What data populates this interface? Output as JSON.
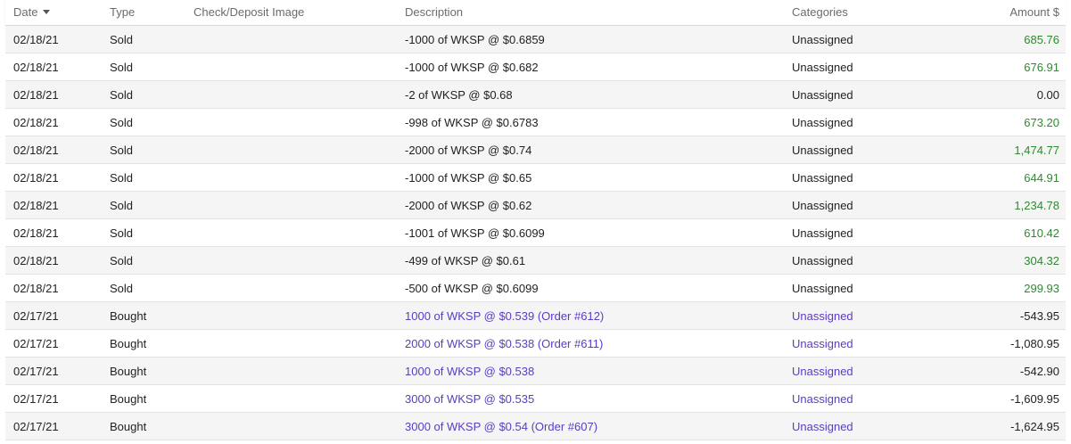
{
  "headers": {
    "date": "Date",
    "type": "Type",
    "image": "Check/Deposit Image",
    "description": "Description",
    "categories": "Categories",
    "amount": "Amount $"
  },
  "rows": [
    {
      "date": "02/18/21",
      "type": "Sold",
      "description": "-1000 of WKSP @ $0.6859",
      "category": "Unassigned",
      "amount": "685.76",
      "sign": "pos",
      "link": false
    },
    {
      "date": "02/18/21",
      "type": "Sold",
      "description": "-1000 of WKSP @ $0.682",
      "category": "Unassigned",
      "amount": "676.91",
      "sign": "pos",
      "link": false
    },
    {
      "date": "02/18/21",
      "type": "Sold",
      "description": "-2 of WKSP @ $0.68",
      "category": "Unassigned",
      "amount": "0.00",
      "sign": "zero",
      "link": false
    },
    {
      "date": "02/18/21",
      "type": "Sold",
      "description": "-998 of WKSP @ $0.6783",
      "category": "Unassigned",
      "amount": "673.20",
      "sign": "pos",
      "link": false
    },
    {
      "date": "02/18/21",
      "type": "Sold",
      "description": "-2000 of WKSP @ $0.74",
      "category": "Unassigned",
      "amount": "1,474.77",
      "sign": "pos",
      "link": false
    },
    {
      "date": "02/18/21",
      "type": "Sold",
      "description": "-1000 of WKSP @ $0.65",
      "category": "Unassigned",
      "amount": "644.91",
      "sign": "pos",
      "link": false
    },
    {
      "date": "02/18/21",
      "type": "Sold",
      "description": "-2000 of WKSP @ $0.62",
      "category": "Unassigned",
      "amount": "1,234.78",
      "sign": "pos",
      "link": false
    },
    {
      "date": "02/18/21",
      "type": "Sold",
      "description": "-1001 of WKSP @ $0.6099",
      "category": "Unassigned",
      "amount": "610.42",
      "sign": "pos",
      "link": false
    },
    {
      "date": "02/18/21",
      "type": "Sold",
      "description": "-499 of WKSP @ $0.61",
      "category": "Unassigned",
      "amount": "304.32",
      "sign": "pos",
      "link": false
    },
    {
      "date": "02/18/21",
      "type": "Sold",
      "description": "-500 of WKSP @ $0.6099",
      "category": "Unassigned",
      "amount": "299.93",
      "sign": "pos",
      "link": false
    },
    {
      "date": "02/17/21",
      "type": "Bought",
      "description": "1000 of WKSP @ $0.539 (Order #612)",
      "category": "Unassigned",
      "amount": "-543.95",
      "sign": "neg",
      "link": true
    },
    {
      "date": "02/17/21",
      "type": "Bought",
      "description": "2000 of WKSP @ $0.538 (Order #611)",
      "category": "Unassigned",
      "amount": "-1,080.95",
      "sign": "neg",
      "link": true
    },
    {
      "date": "02/17/21",
      "type": "Bought",
      "description": "1000 of WKSP @ $0.538",
      "category": "Unassigned",
      "amount": "-542.90",
      "sign": "neg",
      "link": true
    },
    {
      "date": "02/17/21",
      "type": "Bought",
      "description": "3000 of WKSP @ $0.535",
      "category": "Unassigned",
      "amount": "-1,609.95",
      "sign": "neg",
      "link": true
    },
    {
      "date": "02/17/21",
      "type": "Bought",
      "description": "3000 of WKSP @ $0.54 (Order #607)",
      "category": "Unassigned",
      "amount": "-1,624.95",
      "sign": "neg",
      "link": true
    }
  ],
  "colors": {
    "positive": "#2f8a2f",
    "link": "#5b3cc4",
    "text": "#222222",
    "header_text": "#6b6b6b",
    "alt_row": "#f5f5f5"
  },
  "icons": {
    "sort": "sort-descending-icon"
  }
}
